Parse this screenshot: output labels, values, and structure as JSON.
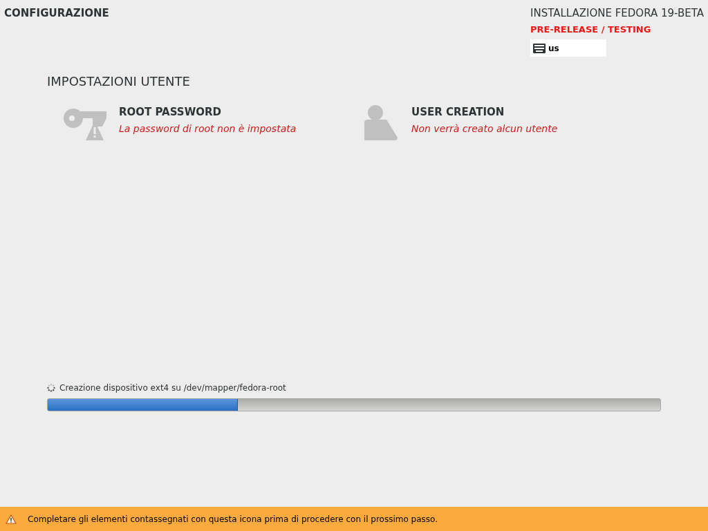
{
  "header": {
    "title": "CONFIGURAZIONE",
    "product": "INSTALLAZIONE FEDORA 19-BETA",
    "release_banner": "PRE-RELEASE / TESTING",
    "keyboard_layout": "us"
  },
  "section": {
    "title": "IMPOSTAZIONI UTENTE",
    "spokes": [
      {
        "kind": "key",
        "title": "ROOT PASSWORD",
        "status": "La password di root non è impostata",
        "warning": true
      },
      {
        "kind": "user",
        "title": "USER CREATION",
        "status": "Non verrà creato alcun utente",
        "warning": false
      }
    ]
  },
  "progress": {
    "message": "Creazione dispositivo ext4 su /dev/mapper/fedora-root",
    "level": 0.31
  },
  "warning_bar": {
    "message": "Completare gli elementi contassegnati con questa icona prima di procedere con il prossimo passo."
  }
}
